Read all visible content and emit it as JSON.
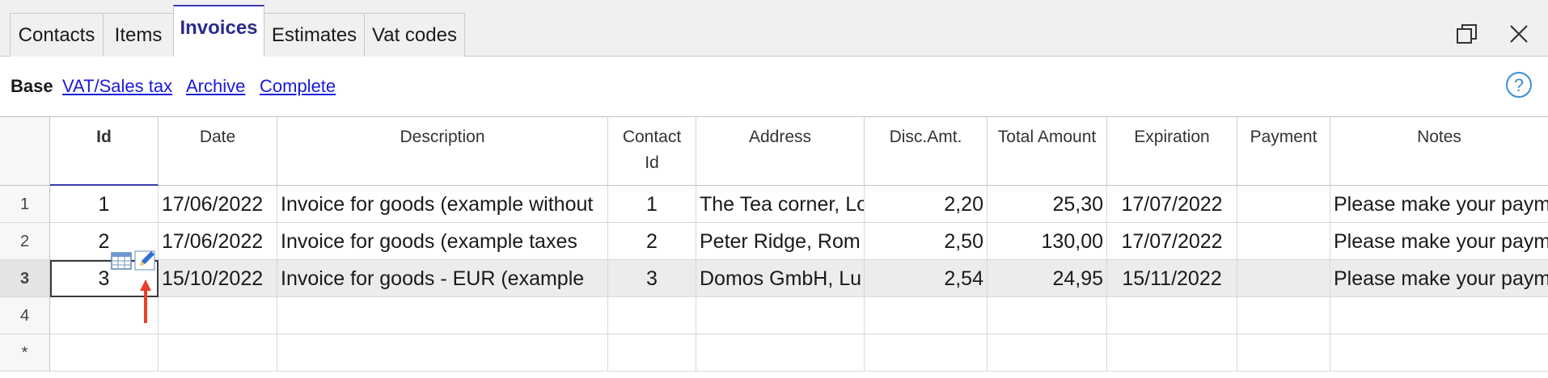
{
  "tabs": [
    {
      "label": "Contacts",
      "active": false
    },
    {
      "label": "Items",
      "active": false
    },
    {
      "label": "Invoices",
      "active": true
    },
    {
      "label": "Estimates",
      "active": false
    },
    {
      "label": "Vat codes",
      "active": false
    }
  ],
  "window_controls": {
    "restore_icon": "restore-window-icon",
    "close_icon": "close-icon"
  },
  "views": {
    "base": "Base",
    "links": [
      "VAT/Sales tax",
      "Archive",
      "Complete"
    ],
    "help_icon": "help-icon"
  },
  "columns": [
    "Id",
    "Date",
    "Description",
    "Contact\nId",
    "Address",
    "Disc.Amt.",
    "Total Amount",
    "Expiration",
    "Payment",
    "Notes"
  ],
  "rows": [
    {
      "num": "1",
      "id": "1",
      "date": "17/06/2022",
      "description": "Invoice for goods (example without",
      "contact_id": "1",
      "address": "The Tea corner, Lo",
      "disc": "2,20",
      "total": "25,30",
      "expiration": "17/07/2022",
      "payment": "",
      "notes": "Please make your paym"
    },
    {
      "num": "2",
      "id": "2",
      "date": "17/06/2022",
      "description": "Invoice for goods (example taxes",
      "contact_id": "2",
      "address": "Peter Ridge, Rom",
      "disc": "2,50",
      "total": "130,00",
      "expiration": "17/07/2022",
      "payment": "",
      "notes": "Please make your paym"
    },
    {
      "num": "3",
      "id": "3",
      "date": "15/10/2022",
      "description": "Invoice for goods - EUR (example",
      "contact_id": "3",
      "address": "Domos GmbH, Lu",
      "disc": "2,54",
      "total": "24,95",
      "expiration": "15/11/2022",
      "payment": "",
      "notes": "Please make your paym"
    },
    {
      "num": "4",
      "id": "",
      "date": "",
      "description": "",
      "contact_id": "",
      "address": "",
      "disc": "",
      "total": "",
      "expiration": "",
      "payment": "",
      "notes": ""
    },
    {
      "num": "*",
      "id": "",
      "date": "",
      "description": "",
      "contact_id": "",
      "address": "",
      "disc": "",
      "total": "",
      "expiration": "",
      "payment": "",
      "notes": ""
    }
  ],
  "cell_tools": {
    "table_icon": "table-grid-icon",
    "edit_icon": "pencil-edit-icon"
  },
  "colors": {
    "accent": "#3a3ab0",
    "link": "#1a1ad8",
    "arrow": "#e8402a",
    "help": "#3b8fd0"
  }
}
